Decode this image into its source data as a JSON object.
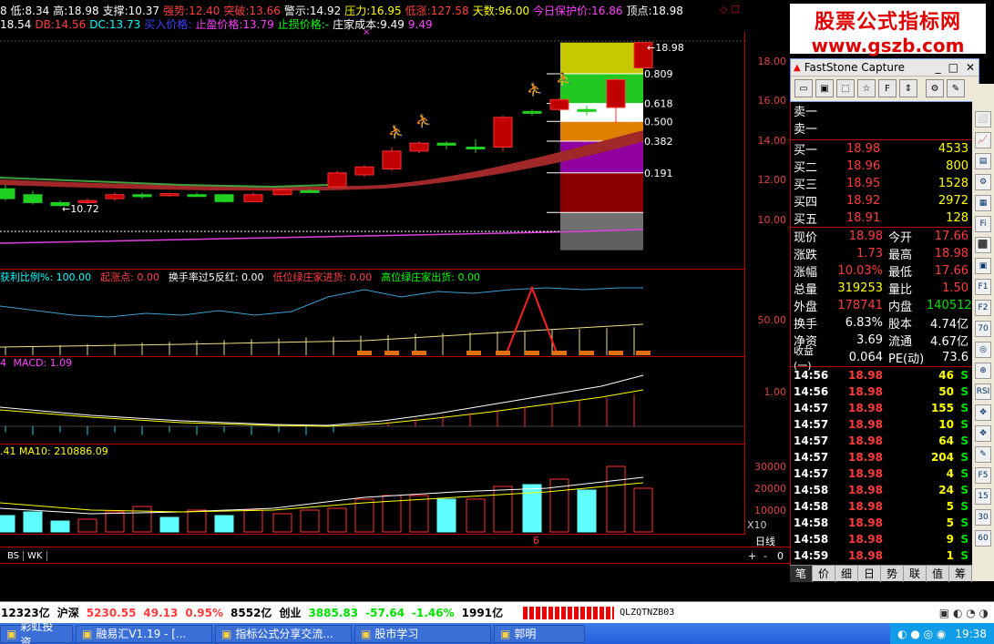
{
  "top_info": {
    "line1": [
      {
        "label": "8 低:",
        "value": "8.34",
        "color": "#ffffff"
      },
      {
        "label": "高:",
        "value": "18.98",
        "color": "#ffffff"
      },
      {
        "label": "支撑:",
        "value": "10.37",
        "color": "#ffffff"
      },
      {
        "label": "强势:",
        "value": "12.40",
        "color": "#ff4040"
      },
      {
        "label": "突破:",
        "value": "13.66",
        "color": "#ff4040"
      },
      {
        "label": "警示:",
        "value": "14.92",
        "color": "#ffffff"
      },
      {
        "label": "压力:",
        "value": "16.95",
        "color": "#ffff00"
      },
      {
        "label": "低涨:",
        "value": "127.58",
        "color": "#ff4040"
      },
      {
        "label": "天数:",
        "value": "96.00",
        "color": "#ffff00"
      },
      {
        "label": "今日保护价:",
        "value": "16.86",
        "color": "#ff40ff"
      },
      {
        "label": "顶点:",
        "value": "18.98",
        "color": "#ffffff"
      }
    ],
    "line2": [
      {
        "label": "",
        "value": "18.54",
        "color": "#ffffff"
      },
      {
        "label": "DB:",
        "value": "14.56",
        "color": "#ff4040"
      },
      {
        "label": "DC:",
        "value": "13.73",
        "color": "#00ffff"
      },
      {
        "label": "买入价格:",
        "value": "",
        "color": "#4040ff"
      },
      {
        "label": "止盈价格:",
        "value": "13.79",
        "color": "#ff40ff"
      },
      {
        "label": "止损价格:",
        "value": "-",
        "color": "#00ff00"
      },
      {
        "label": "庄家成本:",
        "value": "9.49",
        "color": "#ffffff"
      },
      {
        "label": "",
        "value": "9.49",
        "color": "#ff40ff"
      }
    ],
    "cross_mark": "×"
  },
  "main_chart": {
    "y_ticks": [
      "18.00",
      "16.00",
      "14.00",
      "12.00",
      "10.00"
    ],
    "low_label": "10.72",
    "high_label": "18.98",
    "fib_labels": [
      "0.809",
      "0.618",
      "0.500",
      "0.382",
      "0.191"
    ]
  },
  "ind1": {
    "title": [
      {
        "text": "获利比例%: 100.00",
        "color": "#00ffff"
      },
      {
        "text": "起涨点: 0.00",
        "color": "#ff4040"
      },
      {
        "text": "换手率过5反红: 0.00",
        "color": "#ffffff"
      },
      {
        "text": "低位绿庄家进货: 0.00",
        "color": "#ff4040"
      },
      {
        "text": "高位绿庄家出货: 0.00",
        "color": "#00ff00"
      }
    ],
    "y_tick": "50.00"
  },
  "ind2": {
    "title_prefix": "4",
    "title": "MACD: 1.09",
    "y_tick": "1.00"
  },
  "ind3": {
    "title": ".41  MA10: 210886.09",
    "y_ticks": [
      "30000",
      "20000",
      "10000"
    ],
    "unit": "X10"
  },
  "bottom_tabs": [
    "BS",
    "WK"
  ],
  "period_label": "日线",
  "zoom_controls": [
    "+",
    "-",
    "0"
  ],
  "marker_6": "6",
  "quote": {
    "sell_rows": [
      {
        "label": "卖一",
        "price": "",
        "vol": ""
      },
      {
        "label": "卖一",
        "price": "",
        "vol": ""
      }
    ],
    "buy_rows": [
      {
        "label": "买一",
        "price": "18.98",
        "vol": "4533"
      },
      {
        "label": "买二",
        "price": "18.96",
        "vol": "800"
      },
      {
        "label": "买三",
        "price": "18.95",
        "vol": "1528"
      },
      {
        "label": "买四",
        "price": "18.92",
        "vol": "2972"
      },
      {
        "label": "买五",
        "price": "18.91",
        "vol": "128"
      }
    ],
    "stats": [
      {
        "l1": "现价",
        "v1": "18.98",
        "c1": "#ff3c3c",
        "l2": "今开",
        "v2": "17.66",
        "c2": "#ff3c3c"
      },
      {
        "l1": "涨跌",
        "v1": "1.73",
        "c1": "#ff3c3c",
        "l2": "最高",
        "v2": "18.98",
        "c2": "#ff3c3c"
      },
      {
        "l1": "涨幅",
        "v1": "10.03%",
        "c1": "#ff3c3c",
        "l2": "最低",
        "v2": "17.66",
        "c2": "#ff3c3c"
      },
      {
        "l1": "总量",
        "v1": "319253",
        "c1": "#ffff00",
        "l2": "量比",
        "v2": "1.50",
        "c2": "#ff3c3c"
      },
      {
        "l1": "外盘",
        "v1": "178741",
        "c1": "#ff3c3c",
        "l2": "内盘",
        "v2": "140512",
        "c2": "#00e000"
      },
      {
        "l1": "换手",
        "v1": "6.83%",
        "c1": "#ffffff",
        "l2": "股本",
        "v2": "4.74亿",
        "c2": "#ffffff"
      },
      {
        "l1": "净资",
        "v1": "3.69",
        "c1": "#ffffff",
        "l2": "流通",
        "v2": "4.67亿",
        "c2": "#ffffff"
      },
      {
        "l1": "收益(一)",
        "v1": "0.064",
        "c1": "#ffffff",
        "l2": "PE(动)",
        "v2": "73.6",
        "c2": "#ffffff"
      }
    ],
    "ticks": [
      {
        "time": "14:56",
        "price": "18.98",
        "vol": "46",
        "bs": "S"
      },
      {
        "time": "14:56",
        "price": "18.98",
        "vol": "50",
        "bs": "S"
      },
      {
        "time": "14:57",
        "price": "18.98",
        "vol": "155",
        "bs": "S"
      },
      {
        "time": "14:57",
        "price": "18.98",
        "vol": "10",
        "bs": "S"
      },
      {
        "time": "14:57",
        "price": "18.98",
        "vol": "64",
        "bs": "S"
      },
      {
        "time": "14:57",
        "price": "18.98",
        "vol": "204",
        "bs": "S"
      },
      {
        "time": "14:57",
        "price": "18.98",
        "vol": "4",
        "bs": "S"
      },
      {
        "time": "14:58",
        "price": "18.98",
        "vol": "24",
        "bs": "S"
      },
      {
        "time": "14:58",
        "price": "18.98",
        "vol": "5",
        "bs": "S"
      },
      {
        "time": "14:58",
        "price": "18.98",
        "vol": "5",
        "bs": "S"
      },
      {
        "time": "14:58",
        "price": "18.98",
        "vol": "9",
        "bs": "S"
      },
      {
        "time": "14:59",
        "price": "18.98",
        "vol": "1",
        "bs": "S"
      }
    ],
    "bottom_tabs": [
      "笔",
      "价",
      "细",
      "日",
      "势",
      "联",
      "值",
      "筹"
    ]
  },
  "watermark": {
    "line1": "股票公式指标网",
    "line2": "www.gszb.com"
  },
  "faststone": {
    "title": "FastStone Capture",
    "controls": [
      "_",
      "□",
      "✕"
    ]
  },
  "side_icons": [
    "⬜",
    "📈",
    "▤",
    "⚙",
    "▦",
    "Fi",
    "⬛",
    "▣",
    "F1",
    "F2",
    "70",
    "◎",
    "⊕",
    "RSI",
    "✥",
    "✥",
    "✎",
    "F5",
    "15",
    "30",
    "60"
  ],
  "status_bar": {
    "items": [
      {
        "text": "12323亿",
        "color": "#ffffff"
      },
      {
        "text": "沪深",
        "color": "#ffffff"
      },
      {
        "text": "5230.55",
        "color": "#ff3c3c"
      },
      {
        "text": "49.13",
        "color": "#ff3c3c"
      },
      {
        "text": "0.95%",
        "color": "#ff3c3c"
      },
      {
        "text": "8552亿",
        "color": "#ffffff"
      },
      {
        "text": "创业",
        "color": "#ffffff"
      },
      {
        "text": "3885.83",
        "color": "#00e000"
      },
      {
        "text": "-57.64",
        "color": "#00e000"
      },
      {
        "text": "-1.46%",
        "color": "#00e000"
      },
      {
        "text": "1991亿",
        "color": "#ffffff"
      }
    ],
    "code": "QLZQTNZB03"
  },
  "taskbar": {
    "items": [
      "彩虹投资...",
      "融易汇V1.19 - [...",
      "指标公式分享交流...",
      "股市学习",
      "郭明"
    ],
    "time": "19:38"
  }
}
